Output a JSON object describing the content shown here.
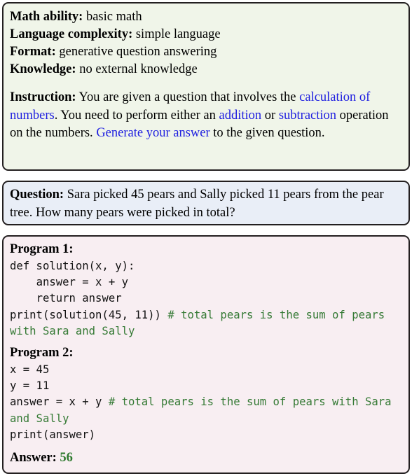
{
  "spec": {
    "rows": [
      {
        "label": "Math ability:",
        "value": " basic math"
      },
      {
        "label": "Language complexity:",
        "value": " simple language"
      },
      {
        "label": "Format:",
        "value": " generative question answering"
      },
      {
        "label": "Knowledge:",
        "value": " no external knowledge"
      }
    ],
    "instruction": {
      "label": "Instruction:",
      "segments": [
        {
          "text": " You are given a question that involves the ",
          "highlight": false
        },
        {
          "text": "calculation of numbers",
          "highlight": true
        },
        {
          "text": ". You need to perform either an ",
          "highlight": false
        },
        {
          "text": "addition",
          "highlight": true
        },
        {
          "text": " or ",
          "highlight": false
        },
        {
          "text": "subtraction",
          "highlight": true
        },
        {
          "text": " operation on the numbers. ",
          "highlight": false
        },
        {
          "text": "Generate your answer",
          "highlight": true
        },
        {
          "text": " to the given question.",
          "highlight": false
        }
      ],
      "plain_text": "Instruction: You are given a question that involves the calculation of numbers. You need to perform either an addition or subtraction operation on the numbers. Generate your answer to the given question."
    }
  },
  "question": {
    "label": "Question:",
    "text": " Sara picked 45 pears and Sally picked 11 pears from the pear tree. How many pears were picked in total?"
  },
  "programs": {
    "program1": {
      "heading": "Program 1:",
      "code_head": "def solution(x, y):\n    answer = x + y\n    return answer\nprint(solution(45, 11)) ",
      "comment": "# total pears is the sum of pears with Sara and Sally"
    },
    "program2": {
      "heading": "Program 2:",
      "code_head": "x = 45\ny = 11\nanswer = x + y ",
      "comment": "# total pears is the sum of pears with Sara and Sally",
      "code_tail": "\nprint(answer)"
    }
  },
  "answer": {
    "label": "Answer:",
    "value": "56"
  },
  "colors": {
    "spec_background": "#f0f5e9",
    "question_background": "#e9eef7",
    "programs_background": "#f8eef2",
    "border": "#231f20",
    "highlight_blue": "#2020e0",
    "comment_green": "#357a35",
    "answer_green": "#2f7a2f"
  }
}
